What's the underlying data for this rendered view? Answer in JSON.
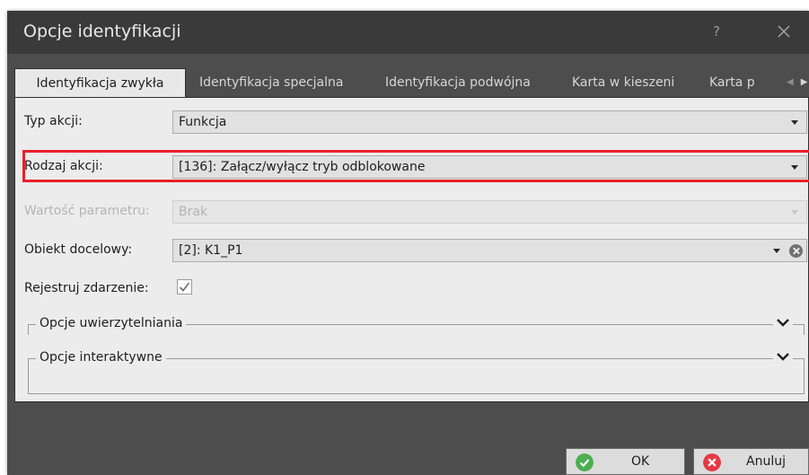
{
  "window": {
    "title": "Opcje identyfikacji",
    "help_label": "?"
  },
  "tabs": [
    {
      "label": "Identyfikacja zwykła",
      "active": true
    },
    {
      "label": "Identyfikacja specjalna",
      "active": false
    },
    {
      "label": "Identyfikacja podwójna",
      "active": false
    },
    {
      "label": "Karta w kieszeni",
      "active": false
    },
    {
      "label": "Karta p",
      "active": false
    }
  ],
  "form": {
    "typ_akcji": {
      "label": "Typ akcji:",
      "value": "Funkcja"
    },
    "rodzaj_akcji": {
      "label": "Rodzaj akcji:",
      "value": "[136]: Załącz/wyłącz tryb odblokowane"
    },
    "wartosc_parametru": {
      "label": "Wartość parametru:",
      "value": "Brak"
    },
    "obiekt_docelowy": {
      "label": "Obiekt docelowy:",
      "value": "[2]: K1_P1"
    },
    "rejestruj_zdarzenie": {
      "label": "Rejestruj zdarzenie:",
      "checked": true
    }
  },
  "groups": {
    "uwierzytelnianie": "Opcje uwierzytelniania",
    "interaktywne": "Opcje interaktywne"
  },
  "buttons": {
    "ok": "OK",
    "cancel": "Anuluj"
  },
  "colors": {
    "highlight": "#e8202a",
    "ok_icon": "#4caf50",
    "cancel_icon": "#e53945"
  }
}
